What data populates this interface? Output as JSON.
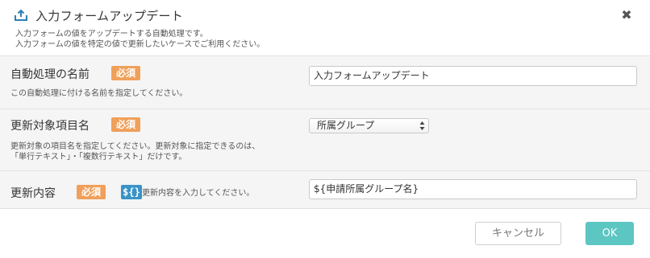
{
  "dialog": {
    "title": "入力フォームアップデート",
    "icon": "upload-tray-icon",
    "close_symbol": "✖",
    "description": [
      "入力フォームの値をアップデートする自動処理です。",
      "入力フォームの値を特定の値で更新したいケースでご利用ください。"
    ]
  },
  "fields": {
    "name": {
      "label": "自動処理の名前",
      "required_badge": "必須",
      "help": "この自動処理に付ける名前を指定してください。",
      "value": "入力フォームアップデート"
    },
    "target": {
      "label": "更新対象項目名",
      "required_badge": "必須",
      "help_lines": [
        "更新対象の項目名を指定してください。更新対象に指定できるのは、",
        "「単行テキスト」・「複数行テキスト」だけです。"
      ],
      "selected": "所属グループ"
    },
    "content": {
      "label": "更新内容",
      "required_badge": "必須",
      "variable_button": "${}",
      "placeholder": "更新内容を入力してください。",
      "value": "${申請所属グループ名}"
    }
  },
  "footer": {
    "cancel_label": "キャンセル",
    "ok_label": "OK"
  },
  "colors": {
    "badge": "#f0a05a",
    "variable_button": "#3a93c7",
    "ok_button": "#5cc6c2",
    "title_icon": "#2f7fb5"
  }
}
